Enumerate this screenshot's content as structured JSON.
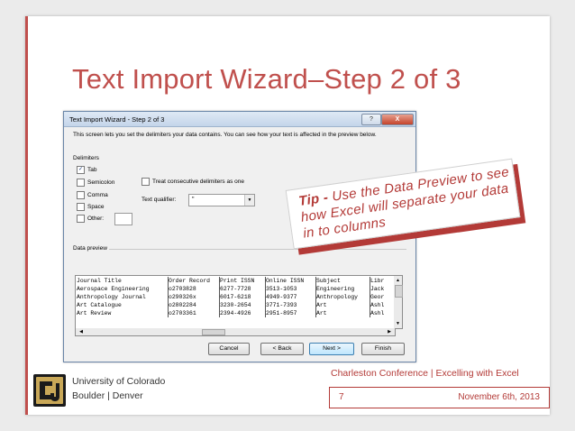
{
  "slide": {
    "title": "Text Import Wizard–Step 2 of 3",
    "accent_color": "#c0504d"
  },
  "dialog": {
    "title": "Text Import Wizard - Step 2 of 3",
    "help_label": "?",
    "close_label": "X",
    "description": "This screen lets you set the delimiters your data contains.  You can see how your text is affected in the preview below.",
    "delimiters_legend": "Delimiters",
    "delimiters": [
      {
        "label": "Tab",
        "checked": true,
        "mark": "✓"
      },
      {
        "label": "Semicolon",
        "checked": false,
        "mark": ""
      },
      {
        "label": "Comma",
        "checked": false,
        "mark": ""
      },
      {
        "label": "Space",
        "checked": false,
        "mark": ""
      },
      {
        "label": "Other:",
        "checked": false,
        "mark": ""
      }
    ],
    "treat_consecutive_label": "Treat consecutive delimiters as one",
    "text_qualifier_label": "Text qualifier:",
    "text_qualifier_value": "\"",
    "data_preview_label": "Data preview",
    "preview_rows": [
      [
        "Journal Title",
        "Order Record",
        "Print ISSN",
        "Online ISSN",
        "Subject",
        "Libr"
      ],
      [
        "Aerospace Engineering",
        "o2703828",
        "6277-7728",
        "3513-1053",
        "Engineering",
        "Jack"
      ],
      [
        "Anthropology Journal",
        "o290326x",
        "6017-6218",
        "4949-9377",
        "Anthropology",
        "Geor"
      ],
      [
        "Art Catalogue",
        "o2802284",
        "3230-2654",
        "3771-7393",
        "Art",
        "Ashl"
      ],
      [
        "Art Review",
        "o2703361",
        "2394-4926",
        "2951-8957",
        "Art",
        "Ashl"
      ]
    ],
    "buttons": {
      "cancel": "Cancel",
      "back": "< Back",
      "next": "Next >",
      "finish": "Finish"
    }
  },
  "tip": {
    "bold": "Tip - ",
    "text": "Use the Data Preview to see how Excel will separate your data in to columns"
  },
  "footer": {
    "conference": "Charleston Conference | Excelling with Excel",
    "page_number": "7",
    "date": "November 6th, 2013",
    "university_line1": "University of Colorado",
    "university_line2": "Boulder | Denver"
  }
}
